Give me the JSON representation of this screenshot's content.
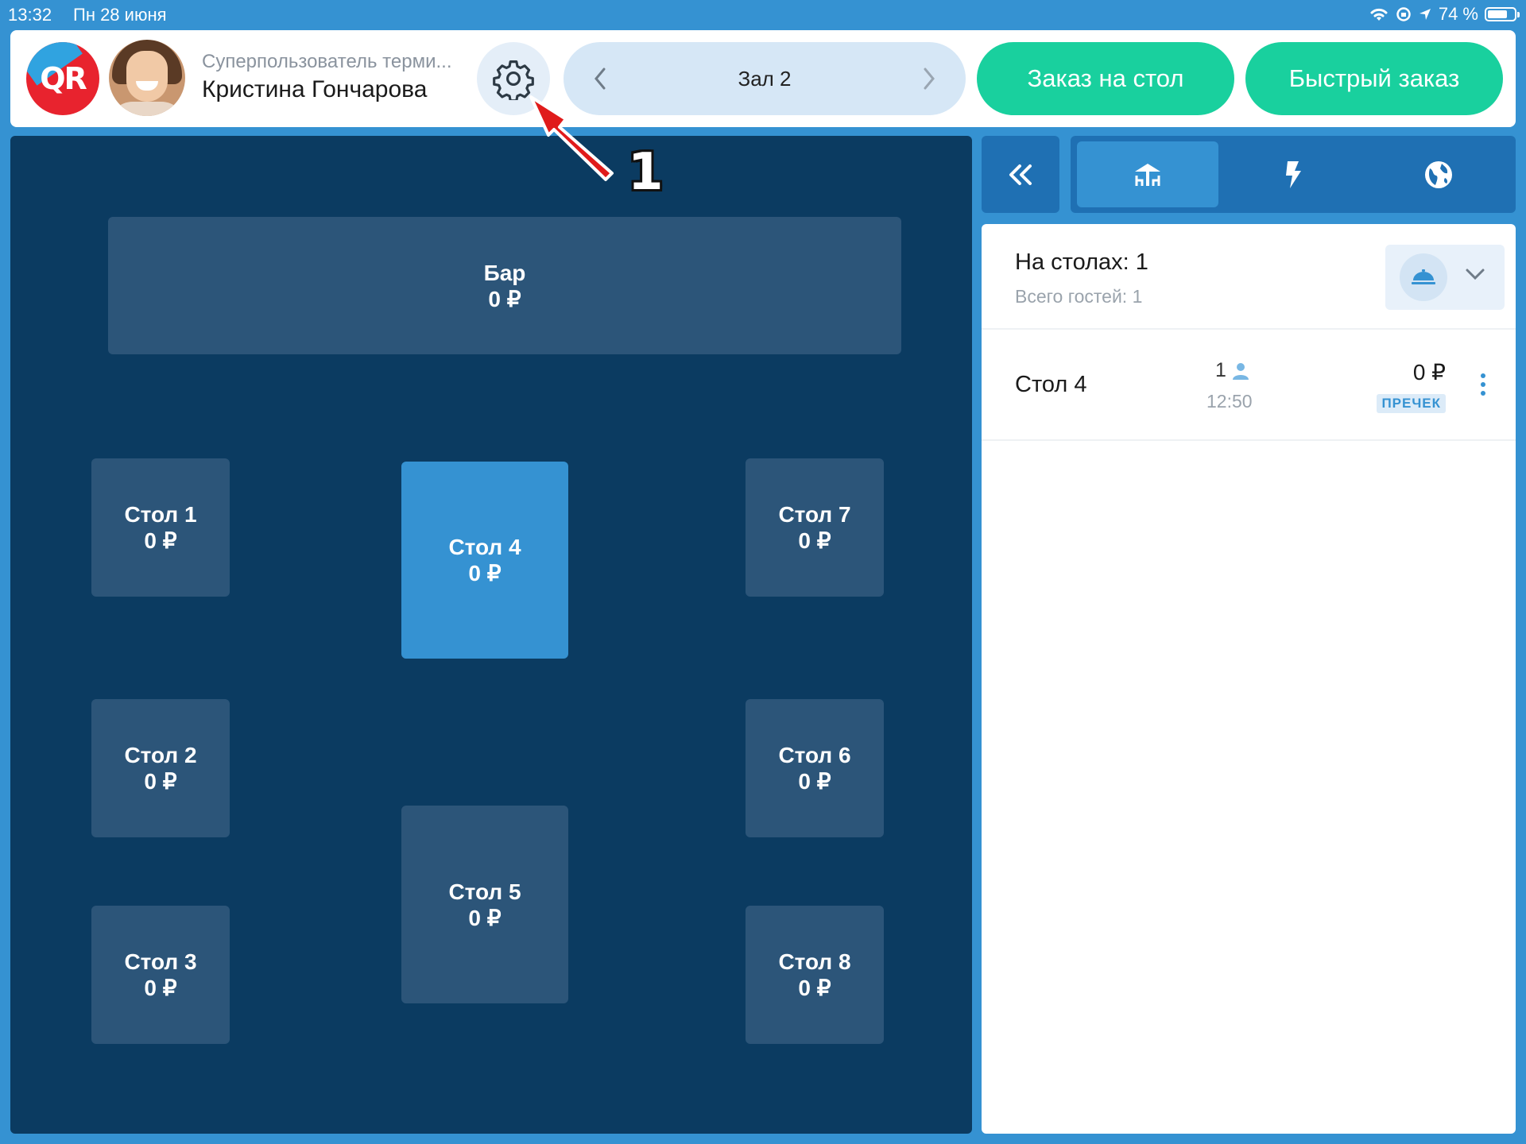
{
  "status_bar": {
    "time": "13:32",
    "date": "Пн 28 июня",
    "battery": "74 %",
    "battery_level": 0.74
  },
  "header": {
    "logo_text": "QR",
    "user_role": "Суперпользователь терми...",
    "user_name": "Кристина Гончарова",
    "hall_name": "Зал 2",
    "order_table_label": "Заказ на стол",
    "quick_order_label": "Быстрый заказ"
  },
  "annotation": {
    "number": "1"
  },
  "floor": {
    "bar": {
      "name": "Бар",
      "amount": "0 ₽"
    },
    "tables": [
      {
        "name": "Стол 1",
        "amount": "0 ₽"
      },
      {
        "name": "Стол 4",
        "amount": "0 ₽"
      },
      {
        "name": "Стол 7",
        "amount": "0 ₽"
      },
      {
        "name": "Стол 2",
        "amount": "0 ₽"
      },
      {
        "name": "Стол 6",
        "amount": "0 ₽"
      },
      {
        "name": "Стол 5",
        "amount": "0 ₽"
      },
      {
        "name": "Стол 3",
        "amount": "0 ₽"
      },
      {
        "name": "Стол 8",
        "amount": "0 ₽"
      }
    ]
  },
  "panel": {
    "summary_title": "На столах: 1",
    "summary_subtitle": "Всего гостей: 1",
    "orders": [
      {
        "table": "Стол 4",
        "guests": "1",
        "time": "12:50",
        "amount": "0 ₽",
        "status": "ПРЕЧЕК"
      }
    ]
  },
  "colors": {
    "accent": "#3592d2",
    "green": "#19d09e",
    "floor": "#0b3b61",
    "table": "#2c5579"
  }
}
